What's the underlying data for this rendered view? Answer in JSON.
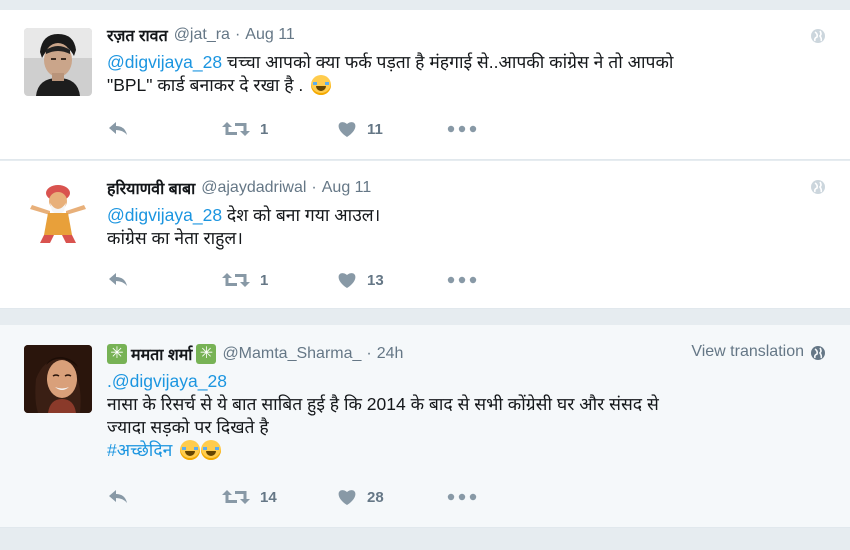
{
  "tweets": [
    {
      "name": "रज़त रावत",
      "handle": "@jat_ra",
      "sep": "·",
      "time": "Aug 11",
      "mention": "@digvijaya_28",
      "text_after_mention": " चच्चा आपको क्या फर्क पड़ता है मंहगाई से..आपकी कांग्रेस ने तो आपको",
      "text_line2": "\"BPL\" कार्ड बनाकर दे रखा है .",
      "emoji": "face-with-tears-of-joy",
      "retweets": "1",
      "likes": "11"
    },
    {
      "name": "हरियाणवी बाबा",
      "handle": "@ajaydadriwal",
      "sep": "·",
      "time": "Aug 11",
      "mention": "@digvijaya_28",
      "text_after_mention": " देश को बना गया आउल।",
      "text_line2": "कांग्रेस का नेता राहुल।",
      "retweets": "1",
      "likes": "13"
    },
    {
      "name": "ममता शर्मा",
      "handle": "@Mamta_Sharma_",
      "sep": "·",
      "time": "24h",
      "translate": "View translation",
      "mention_prefix": ".",
      "mention": "@digvijaya_28",
      "text_line2": "नासा के रिसर्च से ये बात साबित हुई है कि 2014 के बाद से सभी कोंग्रेसी घर और संसद से",
      "text_line3": "ज्यादा सड़को पर दिखते है",
      "hashtag": "#अच्छेदिन",
      "emoji": "face-with-tears-of-joy",
      "retweets": "14",
      "likes": "28"
    }
  ],
  "icons": {
    "reply": "reply-icon",
    "retweet": "retweet-icon",
    "like": "heart-icon",
    "more": "more-icon",
    "globe": "globe-icon",
    "name_badge": "sparkle-leaf-icon"
  },
  "colors": {
    "link": "#1b95e0",
    "meta": "#657786",
    "icon": "#8899a6",
    "background": "#e6ecf0"
  }
}
